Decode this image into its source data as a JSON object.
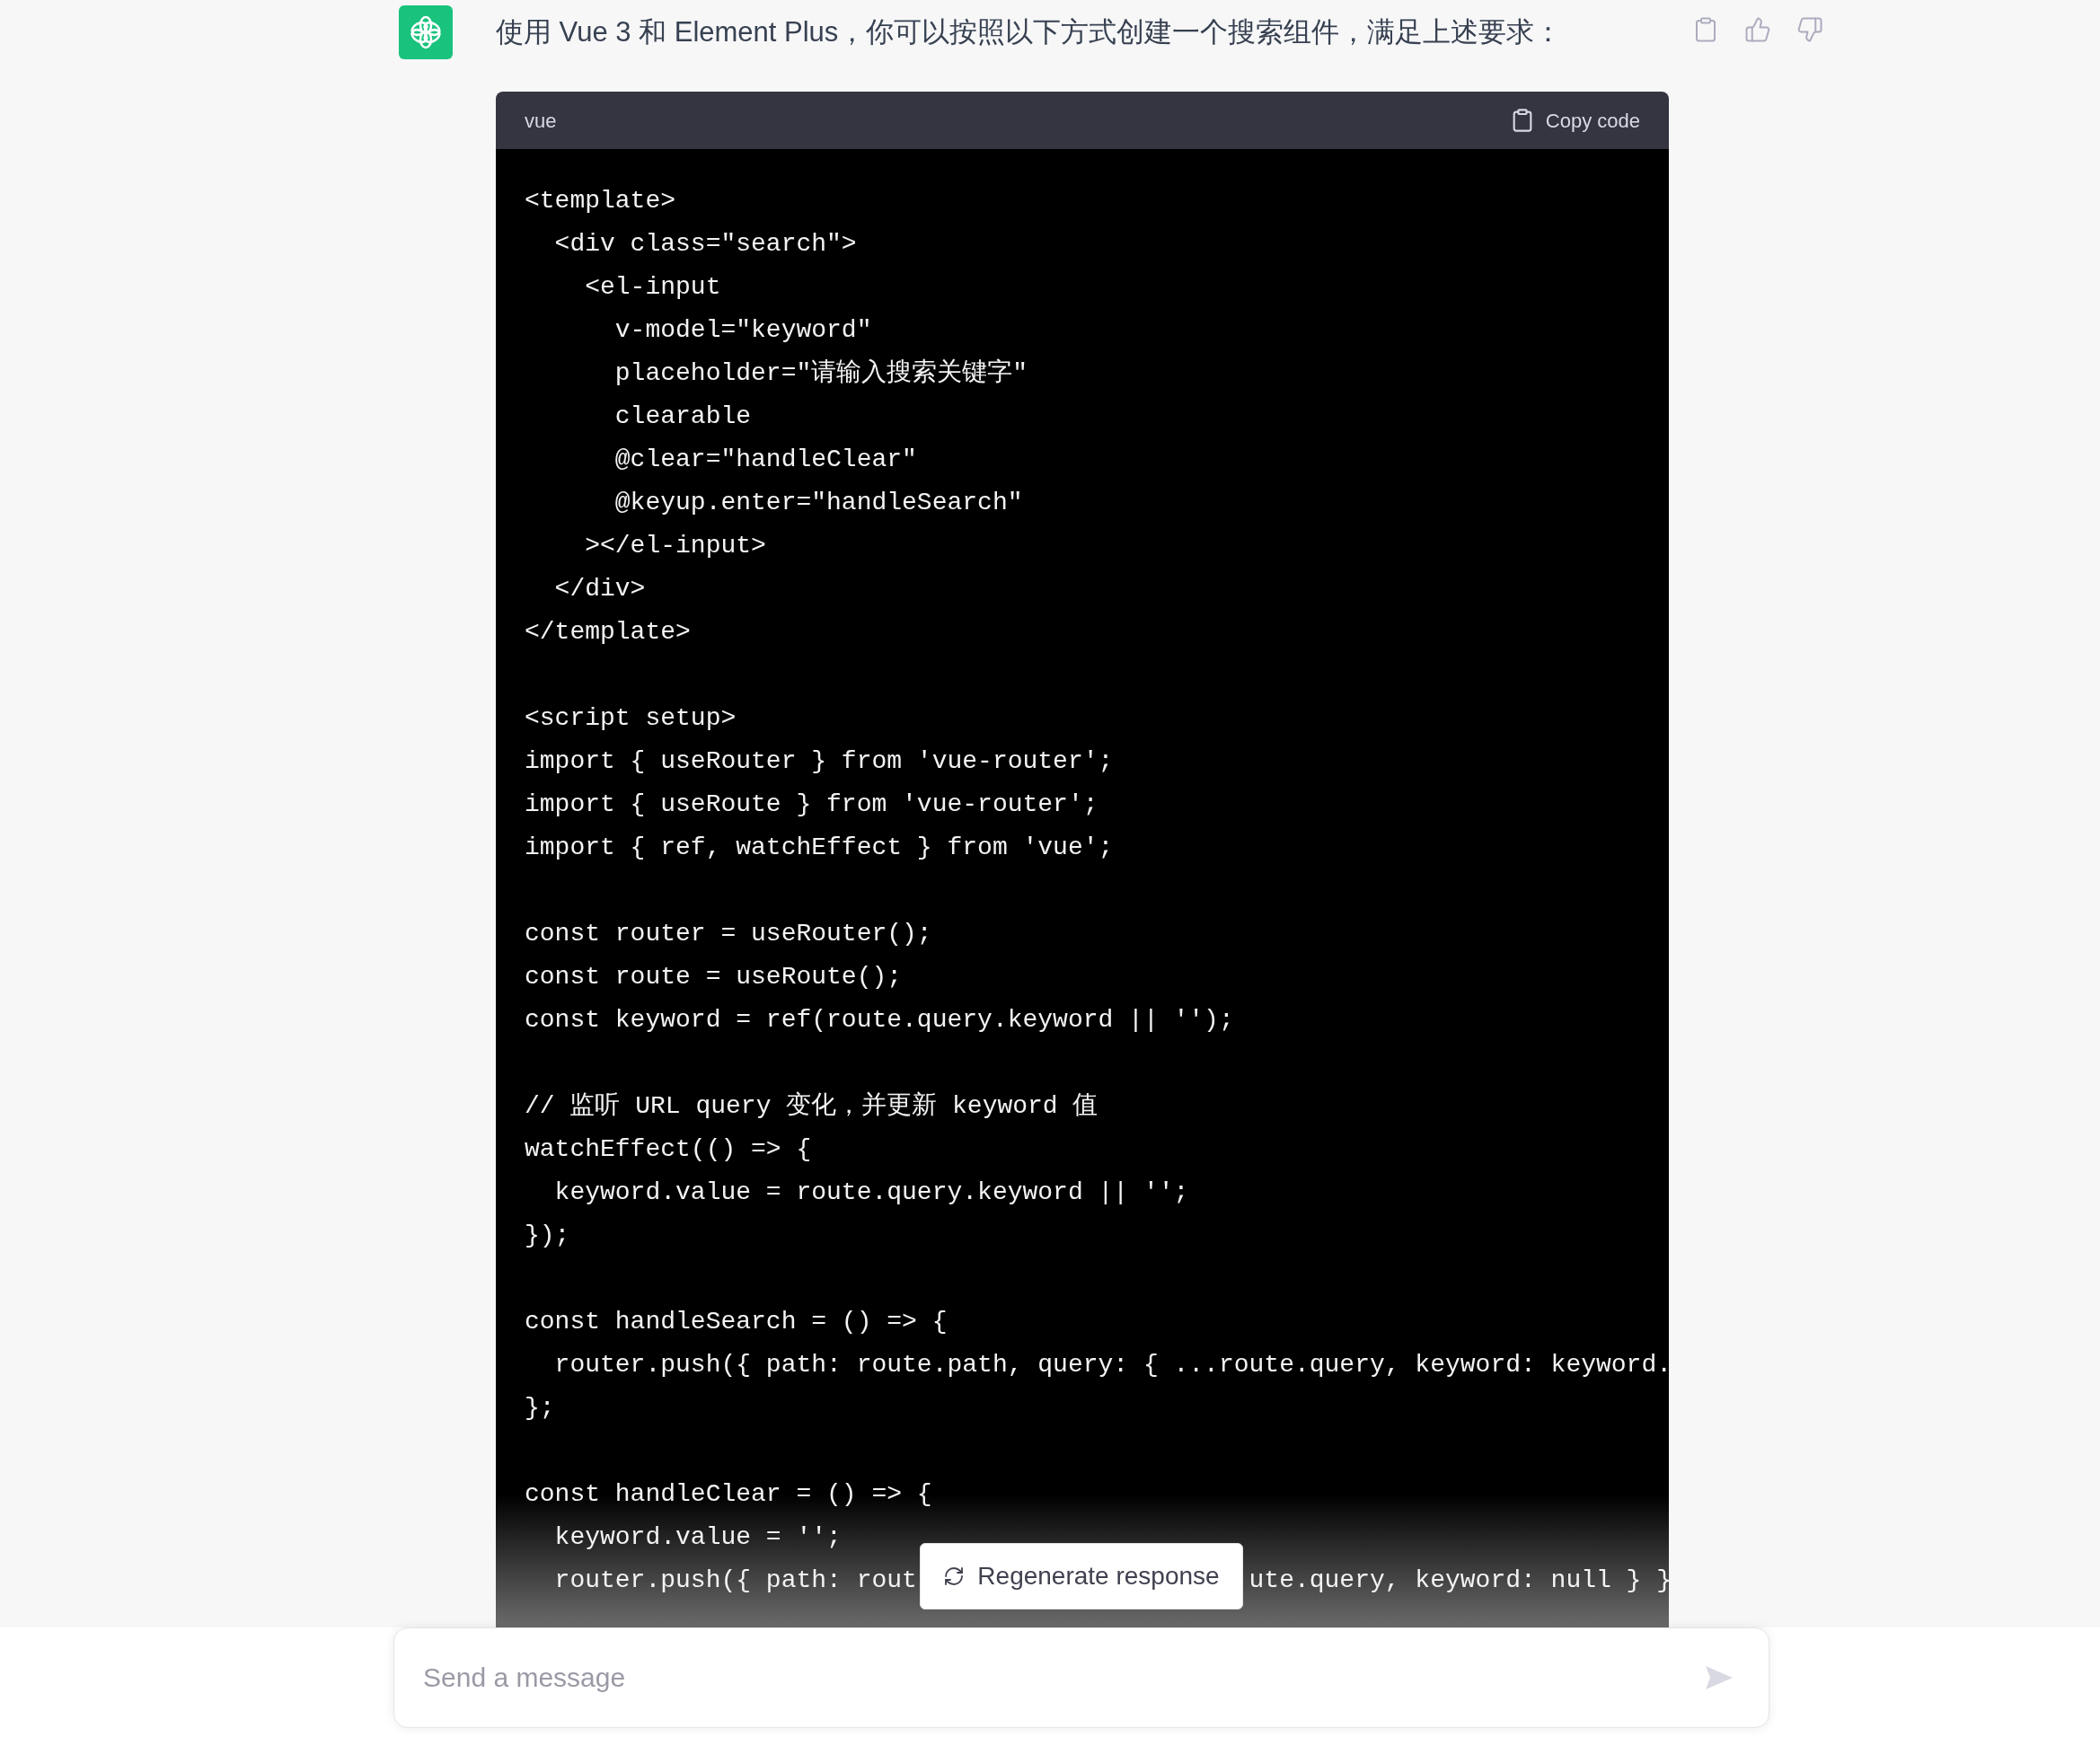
{
  "message": {
    "text": "使用 Vue 3 和 Element Plus，你可以按照以下方式创建一个搜索组件，满足上述要求："
  },
  "code": {
    "language": "vue",
    "copy_label": "Copy code",
    "blocks": [
      [
        {
          "kind": "line",
          "text": "<template>"
        },
        {
          "kind": "line",
          "text": "  <div class=\"search\">"
        },
        {
          "kind": "line",
          "text": "    <el-input"
        },
        {
          "kind": "line",
          "text": "      v-model=\"keyword\""
        },
        {
          "kind": "line",
          "text": "      placeholder=\"请输入搜索关键字\""
        },
        {
          "kind": "line",
          "text": "      clearable"
        },
        {
          "kind": "line",
          "text": "      @clear=\"handleClear\""
        },
        {
          "kind": "line",
          "text": "      @keyup.enter=\"handleSearch\""
        },
        {
          "kind": "line",
          "text": "    ></el-input>"
        },
        {
          "kind": "line",
          "text": "  </div>"
        },
        {
          "kind": "line",
          "text": "</template>"
        }
      ],
      [
        {
          "kind": "line",
          "text": "<script setup>"
        },
        {
          "kind": "line",
          "text": "import { useRouter } from 'vue-router';"
        },
        {
          "kind": "line",
          "text": "import { useRoute } from 'vue-router';"
        },
        {
          "kind": "line",
          "text": "import { ref, watchEffect } from 'vue';"
        }
      ],
      [
        {
          "kind": "line",
          "text": "const router = useRouter();"
        },
        {
          "kind": "line",
          "text": "const route = useRoute();"
        },
        {
          "kind": "line",
          "text": "const keyword = ref(route.query.keyword || '');"
        }
      ],
      [
        {
          "kind": "line",
          "text": "// 监听 URL query 变化，并更新 keyword 值"
        },
        {
          "kind": "line",
          "text": "watchEffect(() => {"
        },
        {
          "kind": "line",
          "text": "  keyword.value = route.query.keyword || '';"
        },
        {
          "kind": "line",
          "text": "});"
        }
      ],
      [
        {
          "kind": "line",
          "text": "const handleSearch = () => {"
        },
        {
          "kind": "line",
          "text": "  router.push({ path: route.path, query: { ...route.query, keyword: keyword."
        },
        {
          "kind": "line",
          "text": "};"
        }
      ],
      [
        {
          "kind": "line",
          "text": "const handleClear = () => {"
        },
        {
          "kind": "line",
          "text": "  keyword.value = '';"
        },
        {
          "kind": "covered",
          "before": "  router.push({ path: rout",
          "after": "ute.query, keyword: null } }"
        }
      ]
    ]
  },
  "regenerate_button": {
    "label": "Regenerate response"
  },
  "composer": {
    "placeholder": "Send a message"
  }
}
